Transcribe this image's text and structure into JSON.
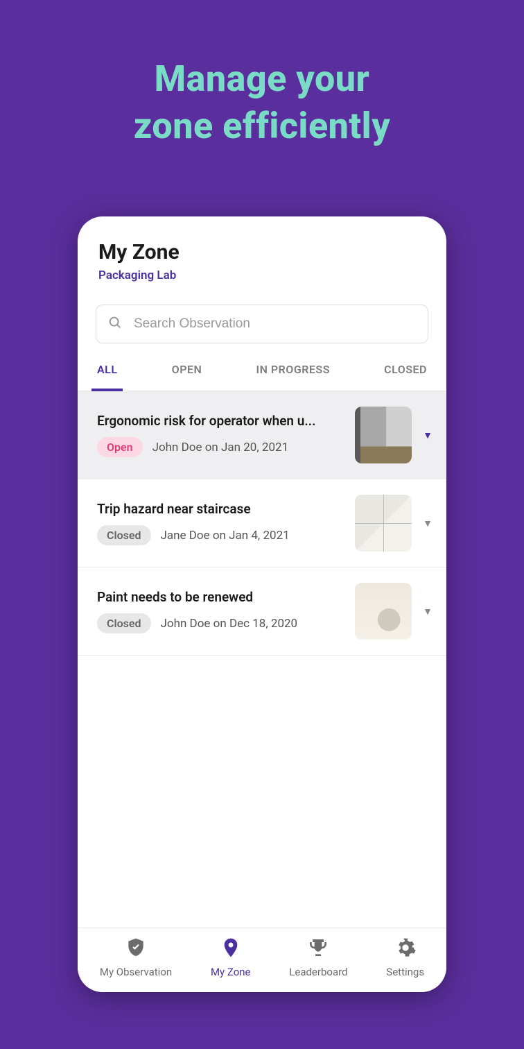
{
  "hero": {
    "line1": "Manage your",
    "line2": "zone efficiently"
  },
  "header": {
    "title": "My Zone",
    "subtitle": "Packaging Lab"
  },
  "search": {
    "placeholder": "Search Observation"
  },
  "tabs": [
    {
      "label": "ALL",
      "active": true
    },
    {
      "label": "OPEN",
      "active": false
    },
    {
      "label": "IN PROGRESS",
      "active": false
    },
    {
      "label": "CLOSED",
      "active": false
    }
  ],
  "items": [
    {
      "title": "Ergonomic risk for operator when u...",
      "status": "Open",
      "status_kind": "open",
      "meta": "John Doe on Jan 20, 2021",
      "thumb": "machine",
      "selected": true
    },
    {
      "title": "Trip hazard near staircase",
      "status": "Closed",
      "status_kind": "closed",
      "meta": "Jane Doe on Jan 4, 2021",
      "thumb": "floor",
      "selected": false
    },
    {
      "title": "Paint needs to be renewed",
      "status": "Closed",
      "status_kind": "closed",
      "meta": "John Doe on Dec 18, 2020",
      "thumb": "wall",
      "selected": false
    }
  ],
  "bottomnav": [
    {
      "label": "My Observation",
      "icon": "shield-check-icon",
      "active": false
    },
    {
      "label": "My Zone",
      "icon": "location-pin-icon",
      "active": true
    },
    {
      "label": "Leaderboard",
      "icon": "trophy-icon",
      "active": false
    },
    {
      "label": "Settings",
      "icon": "gear-icon",
      "active": false
    }
  ]
}
